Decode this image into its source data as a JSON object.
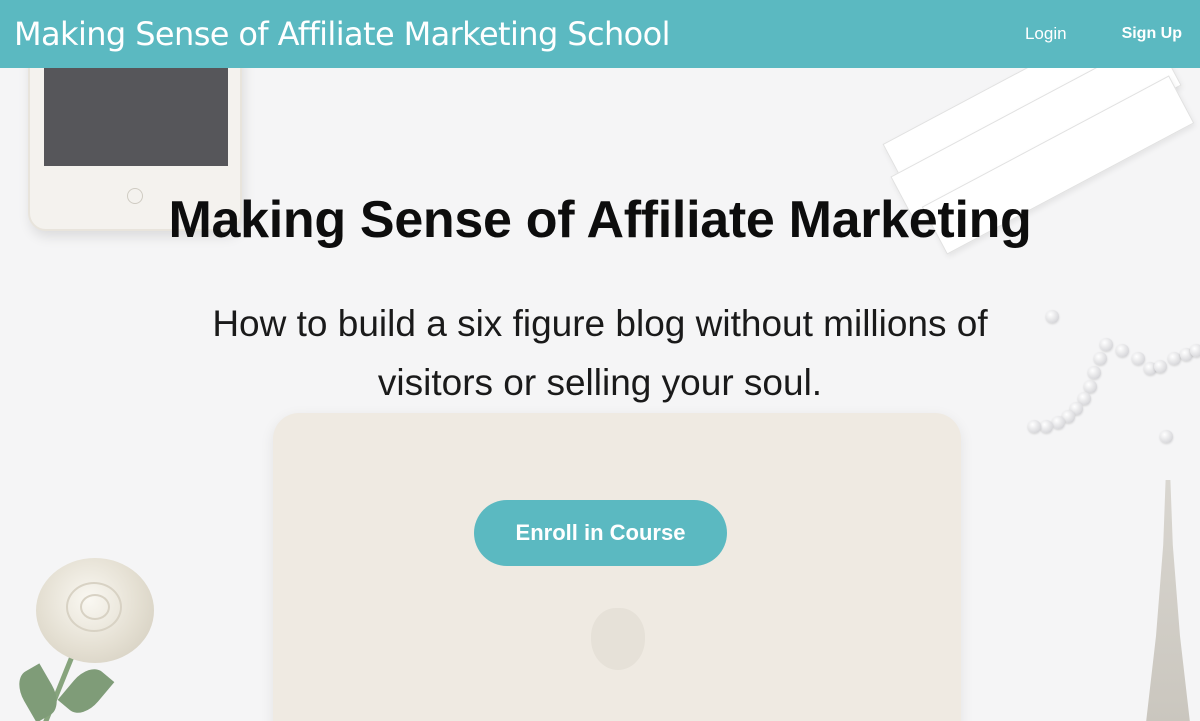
{
  "colors": {
    "accent": "#5bb9c1",
    "hero_background": "#f5f5f6",
    "heading": "#0d0d0d"
  },
  "navbar": {
    "school_name": "Making Sense of Affiliate Marketing School",
    "login_label": "Login",
    "signup_label": "Sign Up"
  },
  "hero": {
    "title": "Making Sense of Affiliate Marketing",
    "subtitle": "How to build a six figure blog without millions of visitors or selling your soul.",
    "cta_label": "Enroll in Course"
  }
}
